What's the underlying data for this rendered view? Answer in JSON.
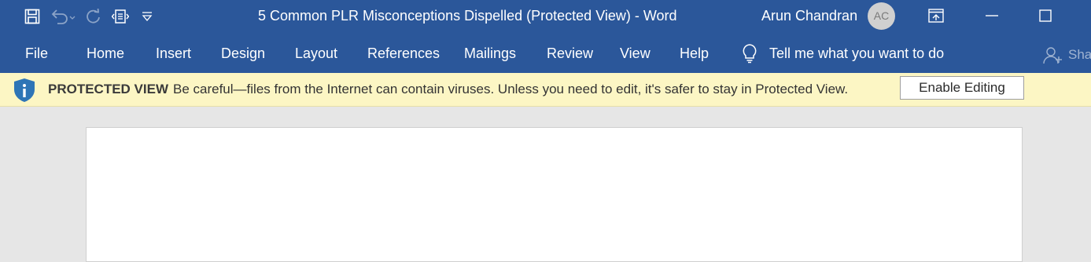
{
  "window": {
    "title": "5 Common PLR Misconceptions Dispelled (Protected View)  -  Word",
    "user_name": "Arun Chandran",
    "user_initials": "AC"
  },
  "quick_access": {
    "icons": [
      "save-icon",
      "undo-icon",
      "redo-icon",
      "touch-mode-icon",
      "customize-dropdown-icon"
    ]
  },
  "ribbon": {
    "tabs": [
      "File",
      "Home",
      "Insert",
      "Design",
      "Layout",
      "References",
      "Mailings",
      "Review",
      "View",
      "Help"
    ],
    "tell_me": "Tell me what you want to do",
    "share": "Sha"
  },
  "protected_view": {
    "title": "PROTECTED VIEW",
    "message": "Be careful—files from the Internet can contain viruses. Unless you need to edit, it's safer to stay in Protected View.",
    "button": "Enable Editing"
  },
  "colors": {
    "accent": "#2b579a",
    "infobar": "#fcf6c4",
    "info_icon": "#2e75b6"
  }
}
